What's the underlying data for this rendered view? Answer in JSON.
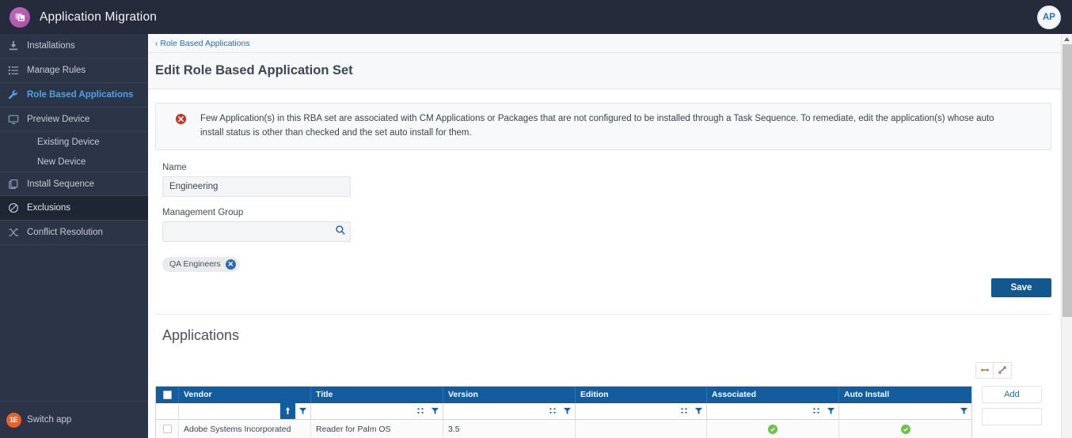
{
  "topbar": {
    "logo_icon": "app-migration-logo-icon",
    "title": "Application Migration",
    "avatar_initials": "AP"
  },
  "sidebar": {
    "items": [
      {
        "label": "Installations",
        "icon": "download-icon",
        "state": "normal"
      },
      {
        "label": "Manage Rules",
        "icon": "list-icon",
        "state": "normal"
      },
      {
        "label": "Role Based Applications",
        "icon": "wrench-icon",
        "state": "active-text"
      },
      {
        "label": "Preview Device",
        "icon": "monitor-icon",
        "state": "normal"
      }
    ],
    "sub_items": [
      {
        "label": "Existing Device"
      },
      {
        "label": "New Device"
      }
    ],
    "items_after": [
      {
        "label": "Install Sequence",
        "icon": "copy-icon",
        "state": "normal"
      },
      {
        "label": "Exclusions",
        "icon": "ban-icon",
        "state": "active-bg"
      },
      {
        "label": "Conflict Resolution",
        "icon": "shuffle-icon",
        "state": "normal"
      }
    ],
    "footer": {
      "label": "Switch app",
      "icon": "one-e-logo-icon",
      "logo_text": "1E"
    }
  },
  "breadcrumb": {
    "label": "Role Based Applications",
    "chevron": "‹"
  },
  "page": {
    "title": "Edit Role Based Application Set"
  },
  "alert": {
    "icon": "error-circle-icon",
    "message": "Few Application(s) in this RBA set are associated with CM Applications or Packages that are not configured to be installed through a Task Sequence. To remediate, edit the application(s) whose auto install status is other than checked and the set auto install for them."
  },
  "form": {
    "name_label": "Name",
    "name_value": "Engineering",
    "name_placeholder": "",
    "management_group_label": "Management Group",
    "management_group_value": "",
    "management_group_placeholder": "",
    "search_icon": "search-icon",
    "chips": [
      {
        "label": "QA Engineers",
        "remove_icon": "remove-chip-icon",
        "remove_glyph": "✕"
      }
    ],
    "save_label": "Save"
  },
  "applications": {
    "section_title": "Applications",
    "toolbar": [
      {
        "icon": "fit-width-icon"
      },
      {
        "icon": "expand-diagonal-icon"
      }
    ],
    "columns": [
      {
        "label": "Vendor",
        "sort": "asc",
        "filter": true
      },
      {
        "label": "Title",
        "sort": "none",
        "filter": true
      },
      {
        "label": "Version",
        "sort": "none",
        "filter": true
      },
      {
        "label": "Edition",
        "sort": "none",
        "filter": true
      },
      {
        "label": "Associated",
        "sort": "none",
        "filter": true
      },
      {
        "label": "Auto Install",
        "sort": null,
        "filter": true
      }
    ],
    "rows": [
      {
        "selected": false,
        "vendor": "Adobe Systems Incorporated",
        "title": "Reader for Palm OS",
        "version": "3.5",
        "edition": "",
        "associated": true,
        "auto_install": true
      }
    ],
    "side_buttons": [
      {
        "label": "Add",
        "blank": false
      },
      {
        "label": "",
        "blank": true
      }
    ]
  },
  "colors": {
    "topbar_bg": "#252b3b",
    "sidebar_bg": "#2c3447",
    "accent_blue": "#2b6cab",
    "grid_header_blue": "#135d9e",
    "primary_button": "#13578f",
    "success_green": "#6cc24a",
    "error_red": "#c0392b",
    "brand_orange": "#e8632a"
  }
}
